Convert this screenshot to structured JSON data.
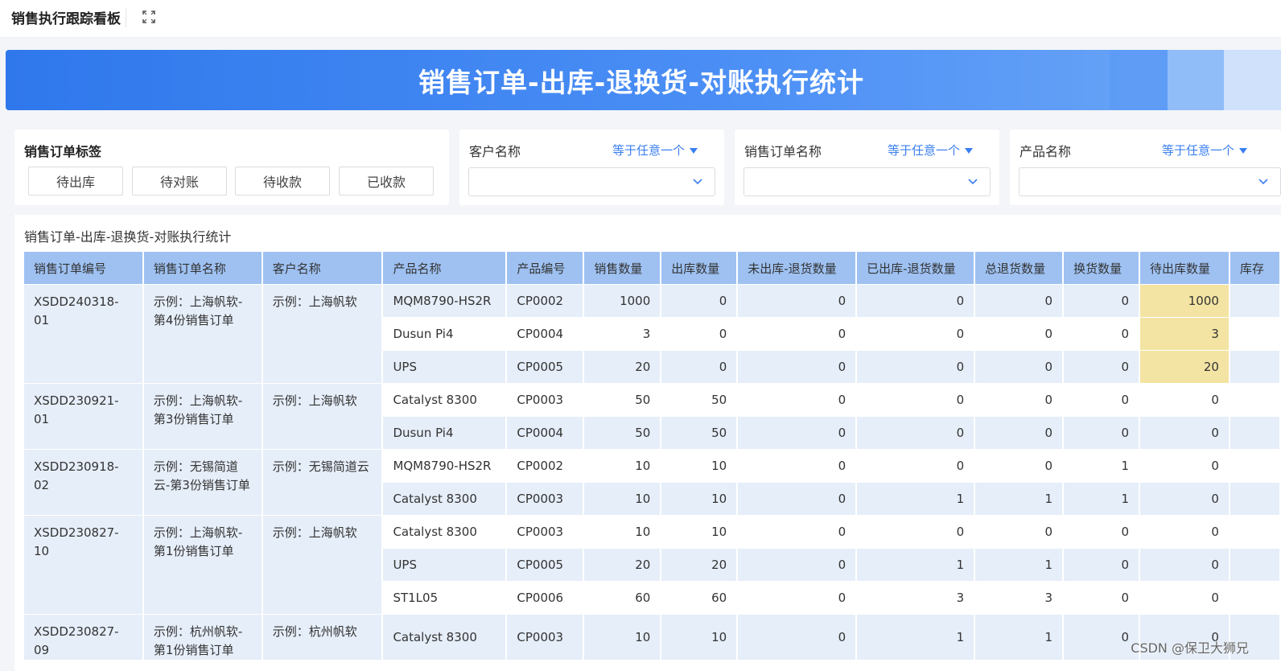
{
  "app": {
    "title": "销售执行跟踪看板"
  },
  "banner": {
    "title": "销售订单-出库-退换货-对账执行统计"
  },
  "tag_filter": {
    "label": "销售订单标签",
    "buttons": [
      "待出库",
      "待对账",
      "待收款",
      "已收款"
    ]
  },
  "filters": [
    {
      "label": "客户名称",
      "operator": "等于任意一个",
      "value": ""
    },
    {
      "label": "销售订单名称",
      "operator": "等于任意一个",
      "value": ""
    },
    {
      "label": "产品名称",
      "operator": "等于任意一个",
      "value": ""
    }
  ],
  "table": {
    "title": "销售订单-出库-退换货-对账执行统计",
    "columns": [
      "销售订单编号",
      "销售订单名称",
      "客户名称",
      "产品名称",
      "产品编号",
      "销售数量",
      "出库数量",
      "未出库-退货数量",
      "已出库-退货数量",
      "总退货数量",
      "换货数量",
      "待出库数量",
      "库存"
    ],
    "orders": [
      {
        "order_no": "XSDD240318-01",
        "order_name": "示例：上海帆软-第4份销售订单",
        "customer": "示例：上海帆软",
        "items": [
          {
            "product": "MQM8790-HS2R",
            "code": "CP0002",
            "sales": "1000",
            "out": "0",
            "unout_ret": "0",
            "out_ret": "0",
            "total_ret": "0",
            "exchange": "0",
            "pending": "1000",
            "pending_hl": true
          },
          {
            "product": "Dusun Pi4",
            "code": "CP0004",
            "sales": "3",
            "out": "0",
            "unout_ret": "0",
            "out_ret": "0",
            "total_ret": "0",
            "exchange": "0",
            "pending": "3",
            "pending_hl": true
          },
          {
            "product": "UPS",
            "code": "CP0005",
            "sales": "20",
            "out": "0",
            "unout_ret": "0",
            "out_ret": "0",
            "total_ret": "0",
            "exchange": "0",
            "pending": "20",
            "pending_hl": true
          }
        ]
      },
      {
        "order_no": "XSDD230921-01",
        "order_name": "示例：上海帆软-第3份销售订单",
        "customer": "示例：上海帆软",
        "items": [
          {
            "product": "Catalyst 8300",
            "code": "CP0003",
            "sales": "50",
            "out": "50",
            "unout_ret": "0",
            "out_ret": "0",
            "total_ret": "0",
            "exchange": "0",
            "pending": "0"
          },
          {
            "product": "Dusun Pi4",
            "code": "CP0004",
            "sales": "50",
            "out": "50",
            "unout_ret": "0",
            "out_ret": "0",
            "total_ret": "0",
            "exchange": "0",
            "pending": "0"
          }
        ]
      },
      {
        "order_no": "XSDD230918-02",
        "order_name": "示例：无锡简道云-第3份销售订单",
        "customer": "示例：无锡简道云",
        "items": [
          {
            "product": "MQM8790-HS2R",
            "code": "CP0002",
            "sales": "10",
            "out": "10",
            "unout_ret": "0",
            "out_ret": "0",
            "total_ret": "0",
            "exchange": "1",
            "pending": "0"
          },
          {
            "product": "Catalyst 8300",
            "code": "CP0003",
            "sales": "10",
            "out": "10",
            "unout_ret": "0",
            "out_ret": "1",
            "total_ret": "1",
            "exchange": "1",
            "pending": "0"
          }
        ]
      },
      {
        "order_no": "XSDD230827-10",
        "order_name": "示例：上海帆软-第1份销售订单",
        "customer": "示例：上海帆软",
        "items": [
          {
            "product": "Catalyst 8300",
            "code": "CP0003",
            "sales": "10",
            "out": "10",
            "unout_ret": "0",
            "out_ret": "0",
            "total_ret": "0",
            "exchange": "0",
            "pending": "0"
          },
          {
            "product": "UPS",
            "code": "CP0005",
            "sales": "20",
            "out": "20",
            "unout_ret": "0",
            "out_ret": "1",
            "total_ret": "1",
            "exchange": "0",
            "pending": "0"
          },
          {
            "product": "ST1L05",
            "code": "CP0006",
            "sales": "60",
            "out": "60",
            "unout_ret": "0",
            "out_ret": "3",
            "total_ret": "3",
            "exchange": "0",
            "pending": "0"
          }
        ]
      },
      {
        "order_no": "XSDD230827-09",
        "order_name": "示例：杭州帆软-第1份销售订单",
        "customer": "示例：杭州帆软",
        "items": [
          {
            "product": "Catalyst 8300",
            "code": "CP0003",
            "sales": "10",
            "out": "10",
            "unout_ret": "0",
            "out_ret": "1",
            "total_ret": "1",
            "exchange": "0",
            "pending": "0"
          }
        ]
      }
    ]
  },
  "watermark": "CSDN @保卫大狮兄",
  "colors": {
    "banner_start": "#2f78ec",
    "header_bg": "#9ec1f2",
    "row_alt": "#e6eef9",
    "highlight": "#f3e4a3",
    "link": "#3a7ff0"
  }
}
